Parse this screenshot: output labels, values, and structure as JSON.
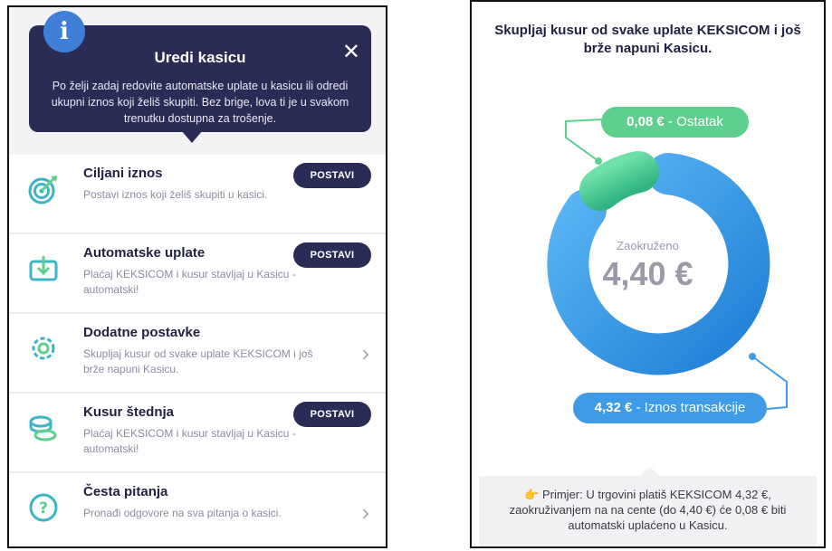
{
  "left": {
    "tooltip": {
      "info_glyph": "i",
      "title": "Uredi kasicu",
      "close_glyph": "✕",
      "text": "Po želji zadaj redovite automatske uplate u kasicu ili odredi ukupni iznos koji želiš skupiti. Bez brige, lova ti je u svakom trenutku dostupna za trošenje."
    },
    "items": [
      {
        "title": "Ciljani iznos",
        "desc": "Postavi iznos koji želiš skupiti u kasici.",
        "action": "POSTAVI",
        "icon": "target-icon"
      },
      {
        "title": "Automatske uplate",
        "desc": "Plaćaj KEKSICOM i kusur stavljaj u Kasicu - automatski!",
        "action": "POSTAVI",
        "icon": "deposit-icon"
      },
      {
        "title": "Dodatne postavke",
        "desc": "Skupljaj kusur od svake uplate KEKSICOM i još brže napuni Kasicu.",
        "icon": "gear-icon"
      },
      {
        "title": "Kusur štednja",
        "desc": "Plaćaj KEKSICOM i kusur stavljaj u Kasicu - automatski!",
        "action": "POSTAVI",
        "icon": "coins-icon"
      },
      {
        "title": "Česta pitanja",
        "desc": "Pronađi odgovore na sva pitanja o kasici.",
        "icon": "question-icon"
      }
    ],
    "chevron": "›"
  },
  "right": {
    "heading": "Skupljaj kusur od svake uplate KEKSICOM i još brže napuni Kasicu.",
    "remainder_value": "0,08 €",
    "remainder_label": "- Ostatak",
    "center_label": "Zaokruženo",
    "center_value": "4,40 €",
    "amount_value": "4,32 €",
    "amount_label": "- Iznos transakcije",
    "example_icon": "👉",
    "example_text": "Primjer: U trgovini platiš KEKSICOM 4,32 €, zaokruživanjem na na cente (do 4,40 €) će 0,08 € biti automatski uplaćeno u Kasicu.",
    "colors": {
      "navy": "#2a2c55",
      "green": "#5fcf8e",
      "blue": "#3f9be6",
      "teal": "#3bb4c6"
    }
  }
}
